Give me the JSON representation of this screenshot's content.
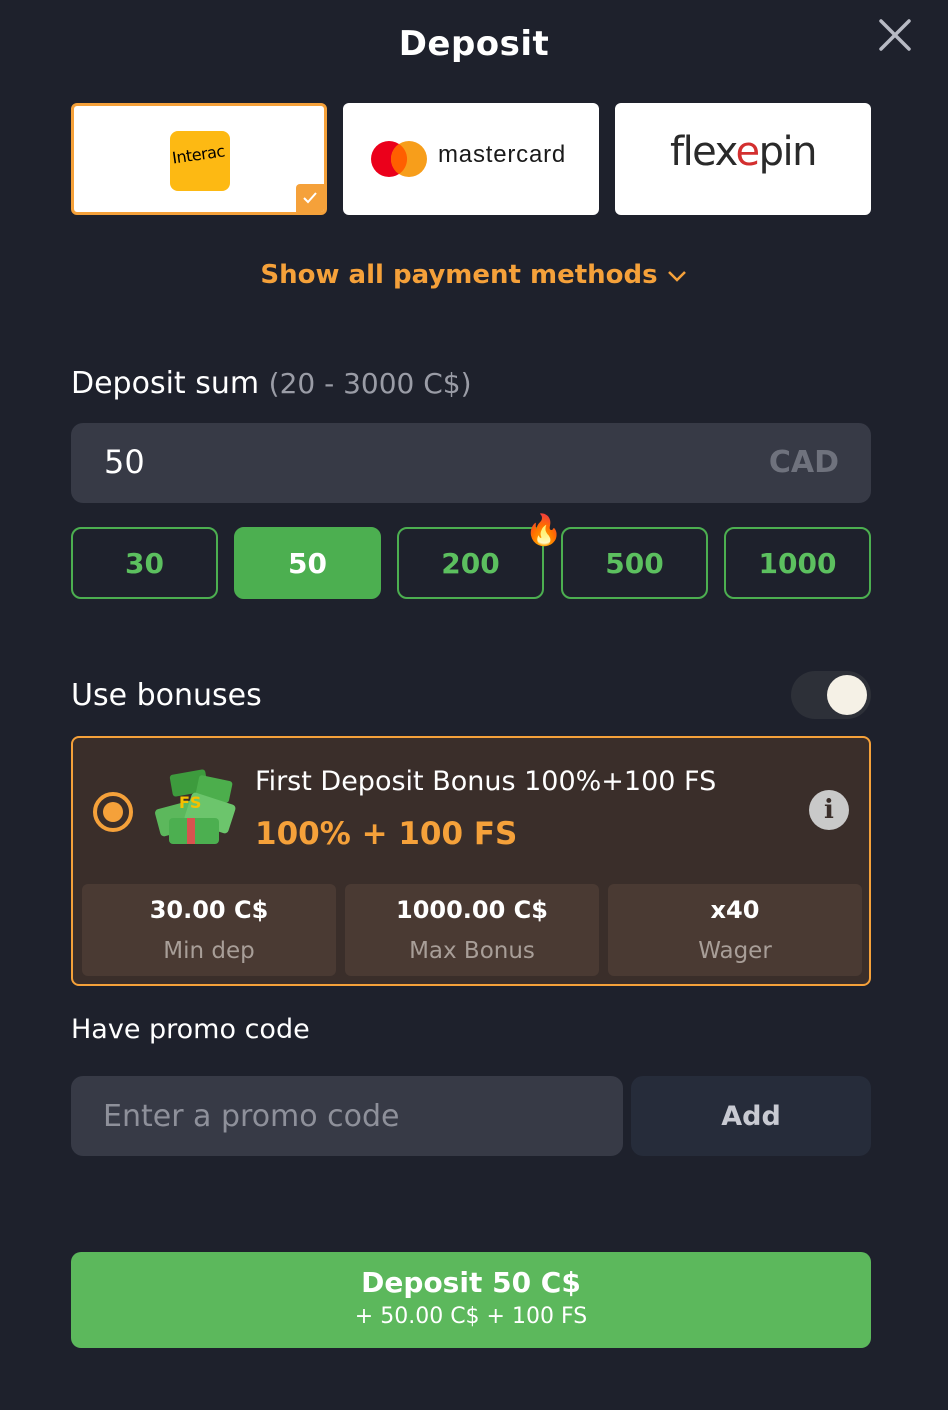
{
  "header": {
    "title": "Deposit"
  },
  "payment_methods": [
    {
      "name": "Interac",
      "logo_text": "Interac",
      "selected": true
    },
    {
      "name": "Mastercard",
      "logo_text": "mastercard",
      "selected": false
    },
    {
      "name": "Flexepin",
      "logo_text_a": "flex",
      "logo_text_e": "e",
      "logo_text_b": "pin",
      "selected": false
    }
  ],
  "show_all_label": "Show all payment methods",
  "deposit_sum": {
    "label": "Deposit sum",
    "range": "(20 - 3000 C$)",
    "value": "50",
    "currency": "CAD"
  },
  "amount_chips": [
    {
      "label": "30",
      "active": false
    },
    {
      "label": "50",
      "active": true
    },
    {
      "label": "200",
      "active": false,
      "hot": true
    },
    {
      "label": "500",
      "active": false
    },
    {
      "label": "1000",
      "active": false
    }
  ],
  "bonuses": {
    "label": "Use bonuses",
    "enabled": true,
    "card": {
      "title": "First Deposit Bonus 100%+100 FS",
      "value": "100% + 100 FS",
      "stats": [
        {
          "value": "30.00 C$",
          "label": "Min dep"
        },
        {
          "value": "1000.00 C$",
          "label": "Max Bonus"
        },
        {
          "value": "x40",
          "label": "Wager"
        }
      ]
    }
  },
  "promo": {
    "label": "Have promo code",
    "placeholder": "Enter a promo code",
    "add_label": "Add"
  },
  "deposit_button": {
    "main": "Deposit 50 C$",
    "sub": "+ 50.00 C$ + 100 FS"
  },
  "colors": {
    "accent_orange": "#f5a13a",
    "accent_green": "#4caf50",
    "background": "#1e212c"
  }
}
